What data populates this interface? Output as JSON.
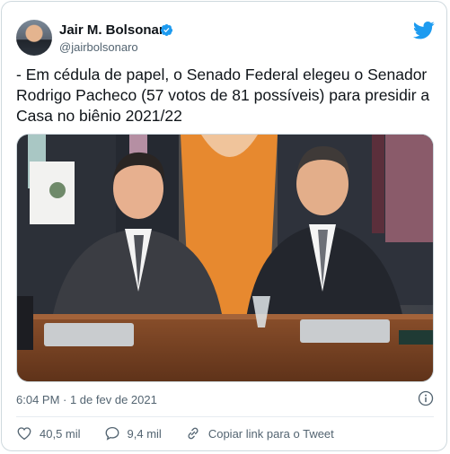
{
  "tweet": {
    "author_name": "Jair M. Bolsonaro",
    "handle": "@jairbolsonaro",
    "text": "- Em cédula de papel, o Senado Federal elegeu o Senador Rodrigo Pacheco (57 votos de 81 possíveis) para presidir a Casa no biênio 2021/22",
    "timestamp": "6:04 PM · 1 de fev de 2021",
    "likes": "40,5 mil",
    "replies": "9,4 mil",
    "copy_link_label": "Copiar link para o Tweet"
  },
  "icons": {
    "verified": "verified-badge-icon",
    "brand": "twitter-bird-icon",
    "info": "info-icon",
    "like": "heart-icon",
    "reply": "reply-bubble-icon",
    "link": "link-icon"
  },
  "colors": {
    "brand": "#1d9bf0",
    "text": "#0f1419",
    "muted": "#536471",
    "border": "#cfd9de"
  }
}
